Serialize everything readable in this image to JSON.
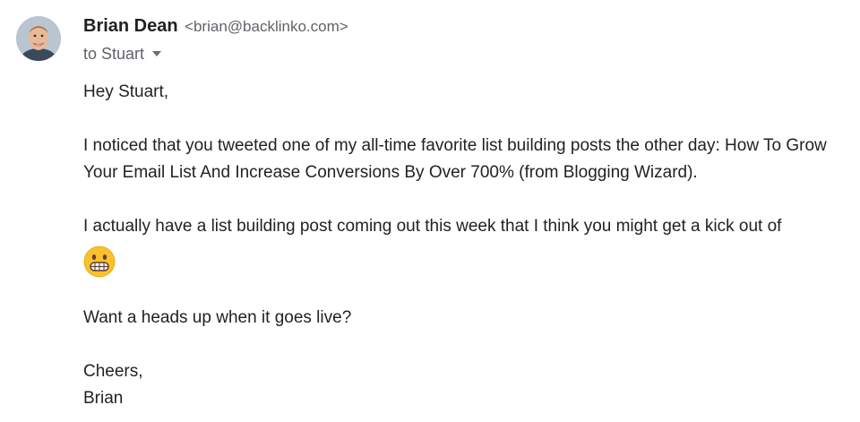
{
  "sender": {
    "name": "Brian Dean",
    "email": "<brian@backlinko.com>"
  },
  "recipient": {
    "to_text": "to Stuart"
  },
  "message": {
    "greeting": "Hey Stuart,",
    "paragraph_1": "I noticed that you tweeted one of my all-time favorite list building posts the other day: How To Grow Your Email List And Increase Conversions By Over 700% (from Blogging Wizard).",
    "paragraph_2": "I actually have a list building post coming out this week that I think you might get a kick out of",
    "emoji": "grinning-face",
    "paragraph_3": "Want a heads up when it goes live?",
    "closing": "Cheers,",
    "signature": "Brian"
  },
  "colors": {
    "sender_name": "#202124",
    "secondary_text": "#5f6368",
    "body_text": "#222222",
    "emoji_yellow": "#fbc02d"
  }
}
